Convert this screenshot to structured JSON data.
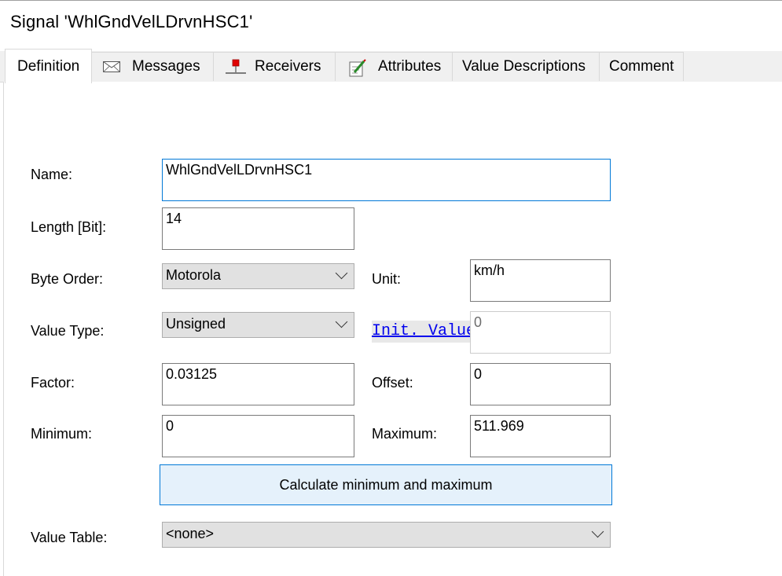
{
  "window": {
    "title": "Signal 'WhlGndVelLDrvnHSC1'"
  },
  "tabs": [
    {
      "label": "Definition",
      "icon": ""
    },
    {
      "label": "Messages",
      "icon": "envelope-icon"
    },
    {
      "label": "Receivers",
      "icon": "receiver-node-icon"
    },
    {
      "label": "Attributes",
      "icon": "edit-attributes-icon"
    },
    {
      "label": "Value Descriptions",
      "icon": ""
    },
    {
      "label": "Comment",
      "icon": ""
    }
  ],
  "form": {
    "name": {
      "label": "Name:",
      "value": "WhlGndVelLDrvnHSC1"
    },
    "length": {
      "label": "Length [Bit]:",
      "value": "14"
    },
    "byte_order": {
      "label": "Byte Order:",
      "value": "Motorola"
    },
    "unit": {
      "label": "Unit:",
      "value": "km/h"
    },
    "value_type": {
      "label": "Value Type:",
      "value": "Unsigned"
    },
    "init_value": {
      "label": "Init. Value",
      "value": "0"
    },
    "factor": {
      "label": "Factor:",
      "value": "0.03125"
    },
    "offset": {
      "label": "Offset:",
      "value": "0"
    },
    "minimum": {
      "label": "Minimum:",
      "value": "0"
    },
    "maximum": {
      "label": "Maximum:",
      "value": "511.969"
    },
    "calculate_button": "Calculate minimum and maximum",
    "value_table": {
      "label": "Value Table:",
      "value": "<none>"
    }
  },
  "colors": {
    "accent": "#0078d7",
    "button_bg": "#e5f1fb",
    "link": "#0000ee",
    "receiver_icon_red": "#e00000"
  }
}
